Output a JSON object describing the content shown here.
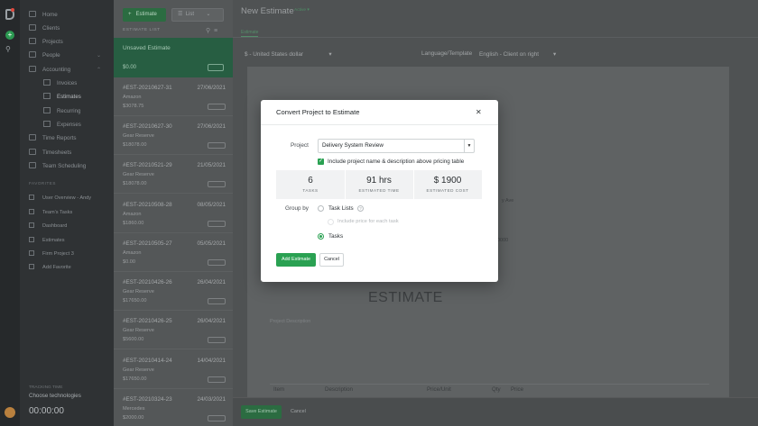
{
  "nav": {
    "items": [
      {
        "label": "Home",
        "icon": "home-icon"
      },
      {
        "label": "Clients",
        "icon": "clients-icon"
      },
      {
        "label": "Projects",
        "icon": "projects-icon"
      },
      {
        "label": "People",
        "icon": "people-icon"
      },
      {
        "label": "Accounting",
        "icon": "accounting-icon"
      }
    ],
    "accounting_sub": [
      {
        "label": "Invoices"
      },
      {
        "label": "Estimates"
      },
      {
        "label": "Recurring"
      },
      {
        "label": "Expenses"
      }
    ],
    "lower_items": [
      {
        "label": "Time Reports"
      },
      {
        "label": "Timesheets"
      },
      {
        "label": "Team Scheduling"
      }
    ],
    "favorites_title": "FAVORITES",
    "favorites": [
      {
        "label": "User Overview - Andy"
      },
      {
        "label": "Team's Tasks"
      },
      {
        "label": "Dashboard"
      },
      {
        "label": "Estimates"
      },
      {
        "label": "Firm Project 3"
      },
      {
        "label": "Add Favorite"
      }
    ],
    "timer_label": "TRACKING TIME",
    "timer_task": "Choose technologies",
    "timer_value": "00:00:00"
  },
  "list": {
    "add_button": "Estimate",
    "view_button": "List",
    "caption": "ESTIMATE LIST",
    "top_item": {
      "title": "Unsaved Estimate",
      "value": "$0.00"
    },
    "items": [
      {
        "number": "#EST-20210627-31",
        "date": "27/06/2021",
        "client": "Amazon",
        "amount": "$3078.75"
      },
      {
        "number": "#EST-20210627-30",
        "date": "27/06/2021",
        "client": "Gear Reserve",
        "amount": "$18078.00"
      },
      {
        "number": "#EST-20210521-29",
        "date": "21/05/2021",
        "client": "Gear Reserve",
        "amount": "$18078.00"
      },
      {
        "number": "#EST-20210508-28",
        "date": "08/05/2021",
        "client": "Amazon",
        "amount": "$1860.00"
      },
      {
        "number": "#EST-20210505-27",
        "date": "05/05/2021",
        "client": "Amazon",
        "amount": "$0.00"
      },
      {
        "number": "#EST-20210426-26",
        "date": "26/04/2021",
        "client": "Gear Reserve",
        "amount": "$17650.00"
      },
      {
        "number": "#EST-20210426-25",
        "date": "26/04/2021",
        "client": "Gear Reserve",
        "amount": "$5600.00"
      },
      {
        "number": "#EST-20210414-24",
        "date": "14/04/2021",
        "client": "Gear Reserve",
        "amount": "$17650.00"
      },
      {
        "number": "#EST-20210324-23",
        "date": "24/03/2021",
        "client": "Mercedes",
        "amount": "$2000.00"
      }
    ]
  },
  "main": {
    "title": "New Estimate",
    "status": "Active",
    "tab": "Estimate",
    "currency": "$ - United States dollar",
    "lang_label": "Language/Template",
    "lang_value": "English - Client on right",
    "doc_heading": "ESTIMATE",
    "doc_desc_placeholder": "Project Description",
    "columns": [
      "Item",
      "Description",
      "Price/Unit",
      "Qty",
      "Price"
    ],
    "side_snippets": [
      "y Ave",
      "0000"
    ],
    "save_button": "Save Estimate",
    "cancel_button": "Cancel"
  },
  "modal": {
    "title": "Convert Project to Estimate",
    "project_label": "Project",
    "project_value": "Delivery System Review",
    "include_label": "Include project name & description above pricing table",
    "include_checked": true,
    "stats": [
      {
        "value": "6",
        "label": "TASKS"
      },
      {
        "value": "91 hrs",
        "label": "ESTIMATED TIME"
      },
      {
        "value": "$ 1900",
        "label": "ESTIMATED COST"
      }
    ],
    "group_by_label": "Group by",
    "options": [
      {
        "label": "Task Lists",
        "selected": false
      },
      {
        "label": "Include price for each task",
        "selected": false
      },
      {
        "label": "Tasks",
        "selected": true
      }
    ],
    "add_button": "Add Estimate",
    "cancel_button": "Cancel"
  },
  "colors": {
    "accent": "#2aa152",
    "overlay_bg": "#3c3f42",
    "modal_bg": "#ffffff"
  }
}
